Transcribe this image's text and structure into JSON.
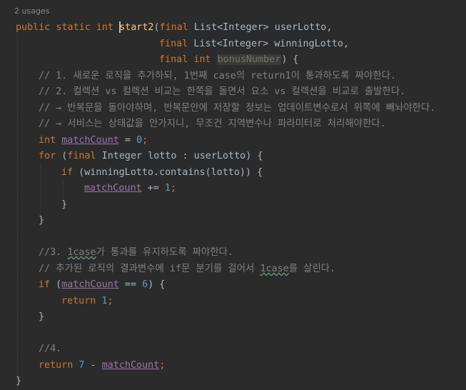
{
  "editor": {
    "usages_hint": "2 usages",
    "lines": {
      "l1": {
        "kw1": "public",
        "kw2": "static",
        "kw3": "int",
        "method": "start2",
        "p1": "(",
        "kw4": "final",
        "type1": " List<Integer> userLotto,"
      },
      "l2": {
        "kw": "final",
        "type": " List<Integer> winningLotto,"
      },
      "l3": {
        "kw1": "final",
        "kw2": "int",
        "param": "bonusNumber",
        "close": ") {"
      },
      "c1": "// 1. 새로운 로직을 추가하되, 1번째 case의 return1이 통과하도록 짜야한다.",
      "c2": "// 2. 컬렉션 vs 컬렉션 비교는 한쪽을 돌면서 요소 vs 컬렉션을 비교로 출발한다.",
      "c3": "// → 반복문을 돌아야하며, 반복문안에 저장할 정보는 업데이트변수로서 위쪽에 빼놔야한다.",
      "c4": "// → 서비스는 상태값을 안가지니, 무조건 지역변수나 파라미터로 처리해야한다.",
      "decl": {
        "kw": "int",
        "var": "matchCount",
        "eq": " = ",
        "num": "0",
        "semi": ";"
      },
      "for": {
        "kw1": "for",
        "open": " (",
        "kw2": "final",
        "rest": " Integer lotto : userLotto) {"
      },
      "if1": {
        "kw": "if",
        "rest": " (winningLotto.contains(lotto)) {"
      },
      "inc": {
        "var": "matchCount",
        "op": " += ",
        "num": "1",
        "semi": ";"
      },
      "brace1": "}",
      "brace2": "}",
      "c5_a": "//3. ",
      "c5_typo": "1case",
      "c5_b": "가 통과를 유지하도록 짜야한다.",
      "c6_a": "// 추가된 로직의 결과변수에 if문 분기를 걸어서 ",
      "c6_typo": "1case",
      "c6_b": "를 살린다.",
      "if2": {
        "kw": "if",
        "open": " (",
        "var": "matchCount",
        "op": " == ",
        "num": "6",
        "close": ") {"
      },
      "ret1": {
        "kw": "return",
        "num": " 1",
        "semi": ";"
      },
      "brace3": "}",
      "c7": "//4.",
      "ret2": {
        "kw": "return",
        "num": " 7",
        "op": " - ",
        "var": "matchCount",
        "semi": ";"
      },
      "brace4": "}"
    }
  },
  "colors": {
    "background": "#2b2b2b",
    "keyword": "#cc7832",
    "method": "#ffc66d",
    "number": "#6897bb",
    "comment": "#808080",
    "local_var": "#9876aa",
    "text": "#a9b7c6"
  }
}
